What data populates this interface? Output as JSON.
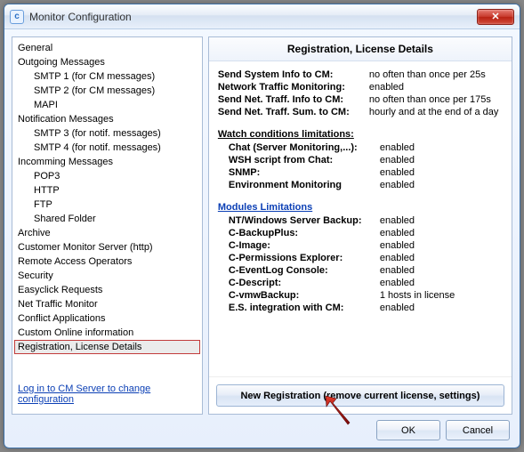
{
  "window": {
    "title": "Monitor Configuration",
    "close_glyph": "✕"
  },
  "tree": {
    "items": [
      {
        "label": "General",
        "indent": 1
      },
      {
        "label": "Outgoing Messages",
        "indent": 1
      },
      {
        "label": "SMTP 1 (for CM messages)",
        "indent": 2
      },
      {
        "label": "SMTP 2 (for CM messages)",
        "indent": 2
      },
      {
        "label": "MAPI",
        "indent": 2
      },
      {
        "label": "Notification Messages",
        "indent": 1
      },
      {
        "label": "SMTP 3 (for notif. messages)",
        "indent": 2
      },
      {
        "label": "SMTP 4 (for notif. messages)",
        "indent": 2
      },
      {
        "label": "Incomming Messages",
        "indent": 1
      },
      {
        "label": "POP3",
        "indent": 2
      },
      {
        "label": "HTTP",
        "indent": 2
      },
      {
        "label": "FTP",
        "indent": 2
      },
      {
        "label": "Shared Folder",
        "indent": 2
      },
      {
        "label": "Archive",
        "indent": 1
      },
      {
        "label": "Customer Monitor Server (http)",
        "indent": 1
      },
      {
        "label": "Remote Access Operators",
        "indent": 1
      },
      {
        "label": "Security",
        "indent": 1
      },
      {
        "label": "Easyclick Requests",
        "indent": 1
      },
      {
        "label": "Net Traffic Monitor",
        "indent": 1
      },
      {
        "label": "Conflict Applications",
        "indent": 1
      },
      {
        "label": "Custom Online information",
        "indent": 1
      },
      {
        "label": "Registration, License Details",
        "indent": 1,
        "selected": true
      }
    ],
    "footer_link": "Log in to CM Server to change configuration"
  },
  "detail": {
    "title": "Registration, License Details",
    "main_rows": [
      {
        "label": "Send System Info to CM:",
        "value": "no often than once per 25s"
      },
      {
        "label": "Network Traffic Monitoring:",
        "value": "enabled"
      },
      {
        "label": "Send Net. Traff. Info to CM:",
        "value": "no often than once per 175s"
      },
      {
        "label": "Send Net. Traff. Sum. to CM:",
        "value": "hourly and at the end of a day"
      }
    ],
    "watch_title": "Watch conditions limitations:",
    "watch_rows": [
      {
        "label": "Chat (Server Monitoring,...):",
        "value": "enabled"
      },
      {
        "label": "WSH script from Chat:",
        "value": "enabled"
      },
      {
        "label": "SNMP:",
        "value": "enabled"
      },
      {
        "label": "Environment Monitoring",
        "value": "enabled"
      }
    ],
    "modules_title": "Modules Limitations",
    "modules_rows": [
      {
        "label": "NT/Windows Server Backup:",
        "value": "enabled"
      },
      {
        "label": "C-BackupPlus:",
        "value": "enabled"
      },
      {
        "label": "C-Image:",
        "value": "enabled"
      },
      {
        "label": "C-Permissions Explorer:",
        "value": "enabled"
      },
      {
        "label": "C-EventLog Console:",
        "value": "enabled"
      },
      {
        "label": "C-Descript:",
        "value": "enabled"
      },
      {
        "label": "C-vmwBackup:",
        "value": "1 hosts in license"
      },
      {
        "label": "E.S. integration with CM:",
        "value": "enabled"
      }
    ],
    "new_reg_button": "New Registration (remove current license, settings)"
  },
  "buttons": {
    "ok": "OK",
    "cancel": "Cancel"
  }
}
